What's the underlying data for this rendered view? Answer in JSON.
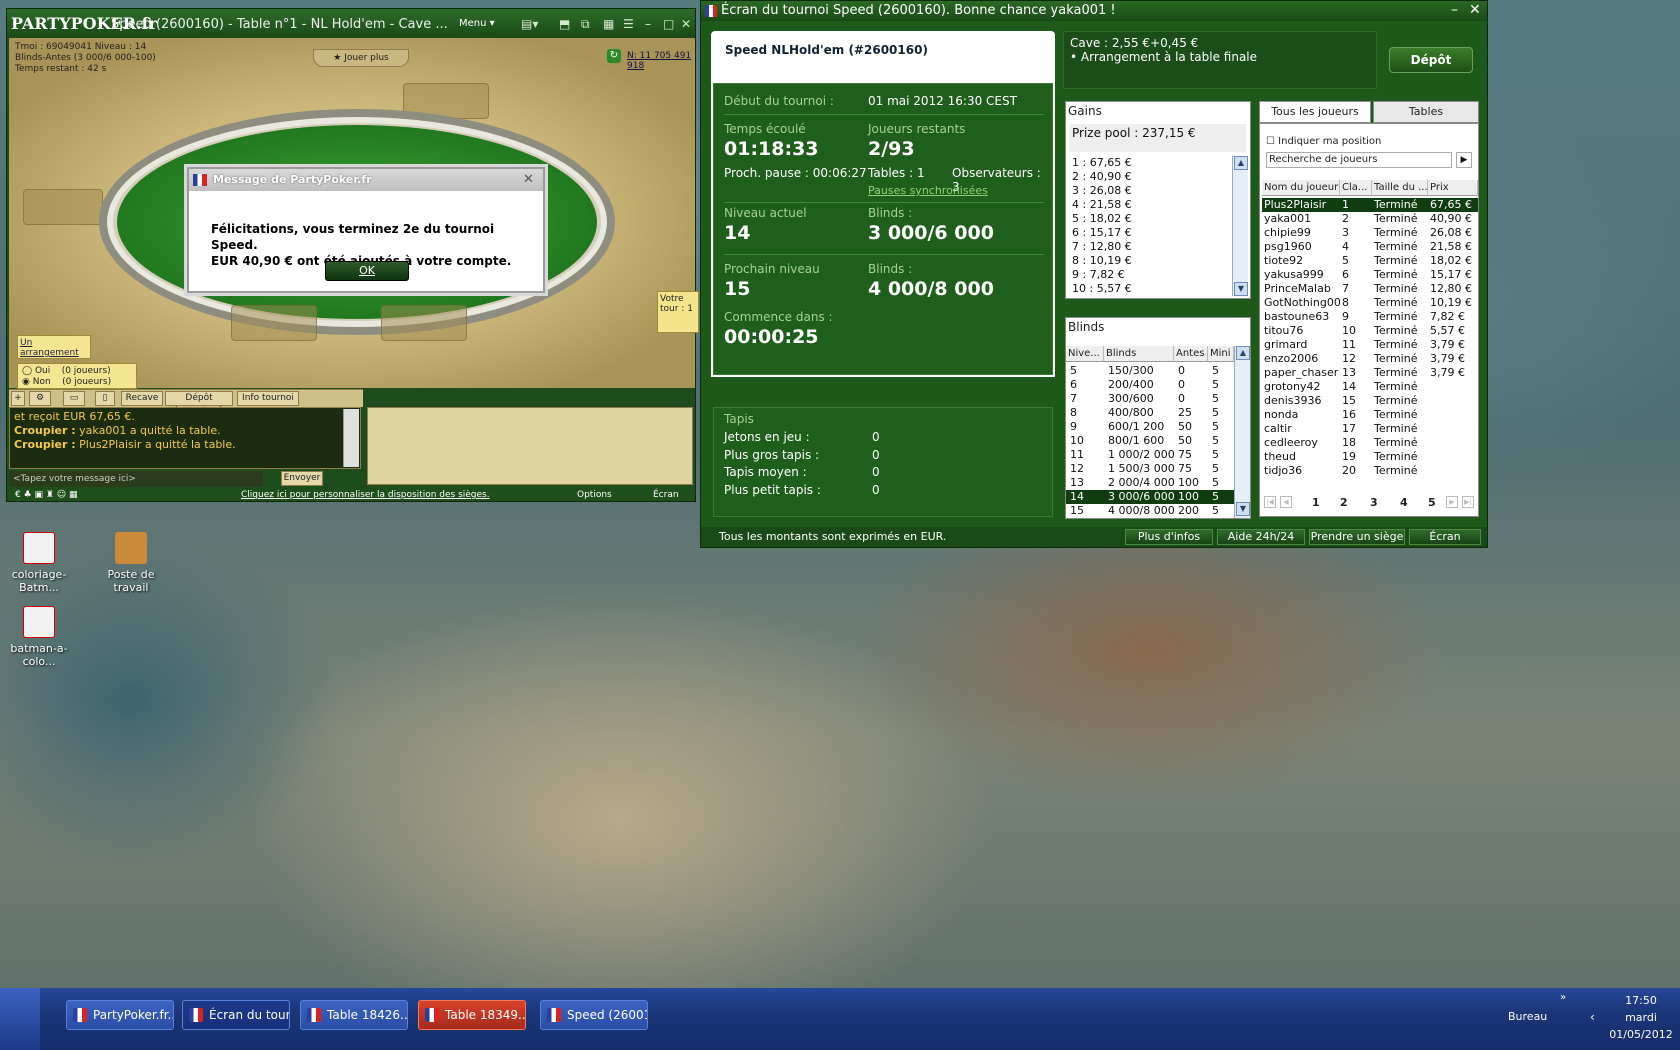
{
  "poker_table": {
    "logo": "PARTYPOKER.fr",
    "title": "Speed (2600160) - Table n°1 - NL Hold'em - Cave ...",
    "menu": "Menu",
    "info_lines": [
      "Tmoi : 69049041 Niveau : 14",
      "Blinds-Antes (3 000/6 000-100)",
      "Temps restant : 42 s"
    ],
    "jouer_plus": "Jouer plus",
    "balance": "N: 11 705 491 918",
    "votre_tour": "Votre tour : 1",
    "arrangement": "Un arrangement",
    "arrangement_oui": "Oui",
    "arrangement_non": "Non",
    "arrangement_count_1": "(0 joueurs)",
    "arrangement_count_2": "(0 joueurs)",
    "dialog": {
      "title": "Message de PartyPoker.fr",
      "line1": "Félicitations, vous terminez 2e du tournoi Speed.",
      "line2": "EUR 40,90 € ont été ajoutés à votre compte.",
      "ok": "OK"
    },
    "toolbar": {
      "recave": "Recave",
      "depot_instantane": "Dépôt instantané",
      "info_tournoi": "Info tournoi"
    },
    "chat": {
      "line1": "et reçoit EUR 67,65 €.",
      "line2_speaker": "Croupier :",
      "line2_text": " yaka001 a quitté la table.",
      "line3_speaker": "Croupier :",
      "line3_text": " Plus2Plaisir a quitté la table."
    },
    "chat_placeholder": "<Tapez votre message ici>",
    "envoyer": "Envoyer",
    "status_link": "Cliquez ici pour personnaliser la disposition des sièges.",
    "options": "Options",
    "ecran": "Écran"
  },
  "tournament": {
    "title": "Écran du tournoi Speed (2600160). Bonne chance yaka001 !",
    "tab_title": "Speed NLHold'em (#2600160)",
    "cave": "Cave : 2,55 €+0,45 €",
    "arrangement": "• Arrangement à la table finale",
    "depot": "Dépôt",
    "debut_label": "Début du tournoi :",
    "debut_value": "01 mai 2012  16:30 CEST",
    "temps_label": "Temps écoulé",
    "temps_value": "01:18:33",
    "joueurs_label": "Joueurs restants",
    "joueurs_value": "2/93",
    "pause": "Proch. pause : 00:06:27",
    "tables": "Tables : 1",
    "observateurs": "Observateurs : 3",
    "pauses_sync": "Pauses synchronisées",
    "niveau_label": "Niveau actuel",
    "niveau_value": "14",
    "blinds_label": "Blinds :",
    "blinds_value": "3 000/6 000",
    "prochain_label": "Prochain niveau",
    "prochain_value": "15",
    "blinds2_label": "Blinds :",
    "blinds2_value": "4 000/8 000",
    "commence_label": "Commence dans :",
    "commence_value": "00:00:25",
    "tapis": {
      "title": "Tapis",
      "rows": [
        {
          "label": "Jetons en jeu :",
          "value": "0"
        },
        {
          "label": "Plus gros tapis :",
          "value": "0"
        },
        {
          "label": "Tapis moyen :",
          "value": "0"
        },
        {
          "label": "Plus petit tapis :",
          "value": "0"
        }
      ]
    },
    "gains": {
      "title": "Gains",
      "prize_pool": "Prize pool : 237,15 €",
      "rows": [
        "1 : 67,65 €",
        "2 : 40,90 €",
        "3 : 26,08 €",
        "4 : 21,58 €",
        "5 : 18,02 €",
        "6 : 15,17 €",
        "7 : 12,80 €",
        "8 : 10,19 €",
        "9 : 7,82 €",
        "10 : 5,57 €"
      ]
    },
    "blinds": {
      "title": "Blinds",
      "headers": [
        "Nive...",
        "Blinds",
        "Antes",
        "Mini"
      ],
      "rows": [
        [
          "5",
          "150/300",
          "0",
          "5"
        ],
        [
          "6",
          "200/400",
          "0",
          "5"
        ],
        [
          "7",
          "300/600",
          "0",
          "5"
        ],
        [
          "8",
          "400/800",
          "25",
          "5"
        ],
        [
          "9",
          "600/1 200",
          "50",
          "5"
        ],
        [
          "10",
          "800/1 600",
          "50",
          "5"
        ],
        [
          "11",
          "1 000/2 000",
          "75",
          "5"
        ],
        [
          "12",
          "1 500/3 000",
          "75",
          "5"
        ],
        [
          "13",
          "2 000/4 000",
          "100",
          "5"
        ],
        [
          "14",
          "3 000/6 000",
          "100",
          "5"
        ],
        [
          "15",
          "4 000/8 000",
          "200",
          "5"
        ]
      ]
    },
    "tabs": {
      "players": "Tous les joueurs",
      "tables": "Tables"
    },
    "indiquer": "Indiquer ma position",
    "search_placeholder": "Recherche de joueurs",
    "player_headers": [
      "Nom du joueur",
      "Cla...",
      "Taille du ...",
      "Prix"
    ],
    "players": [
      [
        "Plus2Plaisir",
        "1",
        "Terminé",
        "67,65 €"
      ],
      [
        "yaka001",
        "2",
        "Terminé",
        "40,90 €"
      ],
      [
        "chipie99",
        "3",
        "Terminé",
        "26,08 €"
      ],
      [
        "psg1960",
        "4",
        "Terminé",
        "21,58 €"
      ],
      [
        "tiote92",
        "5",
        "Terminé",
        "18,02 €"
      ],
      [
        "yakusa999",
        "6",
        "Terminé",
        "15,17 €"
      ],
      [
        "PrinceMalab",
        "7",
        "Terminé",
        "12,80 €"
      ],
      [
        "GotNothing00",
        "8",
        "Terminé",
        "10,19 €"
      ],
      [
        "bastoune63",
        "9",
        "Terminé",
        "7,82 €"
      ],
      [
        "titou76",
        "10",
        "Terminé",
        "5,57 €"
      ],
      [
        "grimard",
        "11",
        "Terminé",
        "3,79 €"
      ],
      [
        "enzo2006",
        "12",
        "Terminé",
        "3,79 €"
      ],
      [
        "paper_chaser",
        "13",
        "Terminé",
        "3,79 €"
      ],
      [
        "grotony42",
        "14",
        "Terminé",
        ""
      ],
      [
        "denis3936",
        "15",
        "Terminé",
        ""
      ],
      [
        "nonda",
        "16",
        "Terminé",
        ""
      ],
      [
        "caltir",
        "17",
        "Terminé",
        ""
      ],
      [
        "cedleeroy",
        "18",
        "Terminé",
        ""
      ],
      [
        "theud",
        "19",
        "Terminé",
        ""
      ],
      [
        "tidjo36",
        "20",
        "Terminé",
        ""
      ]
    ],
    "pages": [
      "1",
      "2",
      "3",
      "4",
      "5"
    ],
    "footer_note": "Tous les montants sont exprimés en EUR.",
    "btn_infos": "Plus d'infos",
    "btn_aide": "Aide 24h/24",
    "btn_siege": "Prendre un siège",
    "btn_ecran": "Écran"
  },
  "desktop": {
    "icons": [
      "coloriage-Batm...",
      "Poste de travail",
      "batman-a-colo..."
    ]
  },
  "taskbar": {
    "tasks": [
      "PartyPoker.fr...",
      "Écran du tour...",
      "Table  18426...",
      "Table  18349...",
      "Speed (26001..."
    ],
    "bureau": "Bureau",
    "time": "17:50",
    "day": "mardi",
    "date": "01/05/2012"
  },
  "colors": {
    "party_green": "#1f5f1c",
    "accent_red": "#d8432c"
  }
}
